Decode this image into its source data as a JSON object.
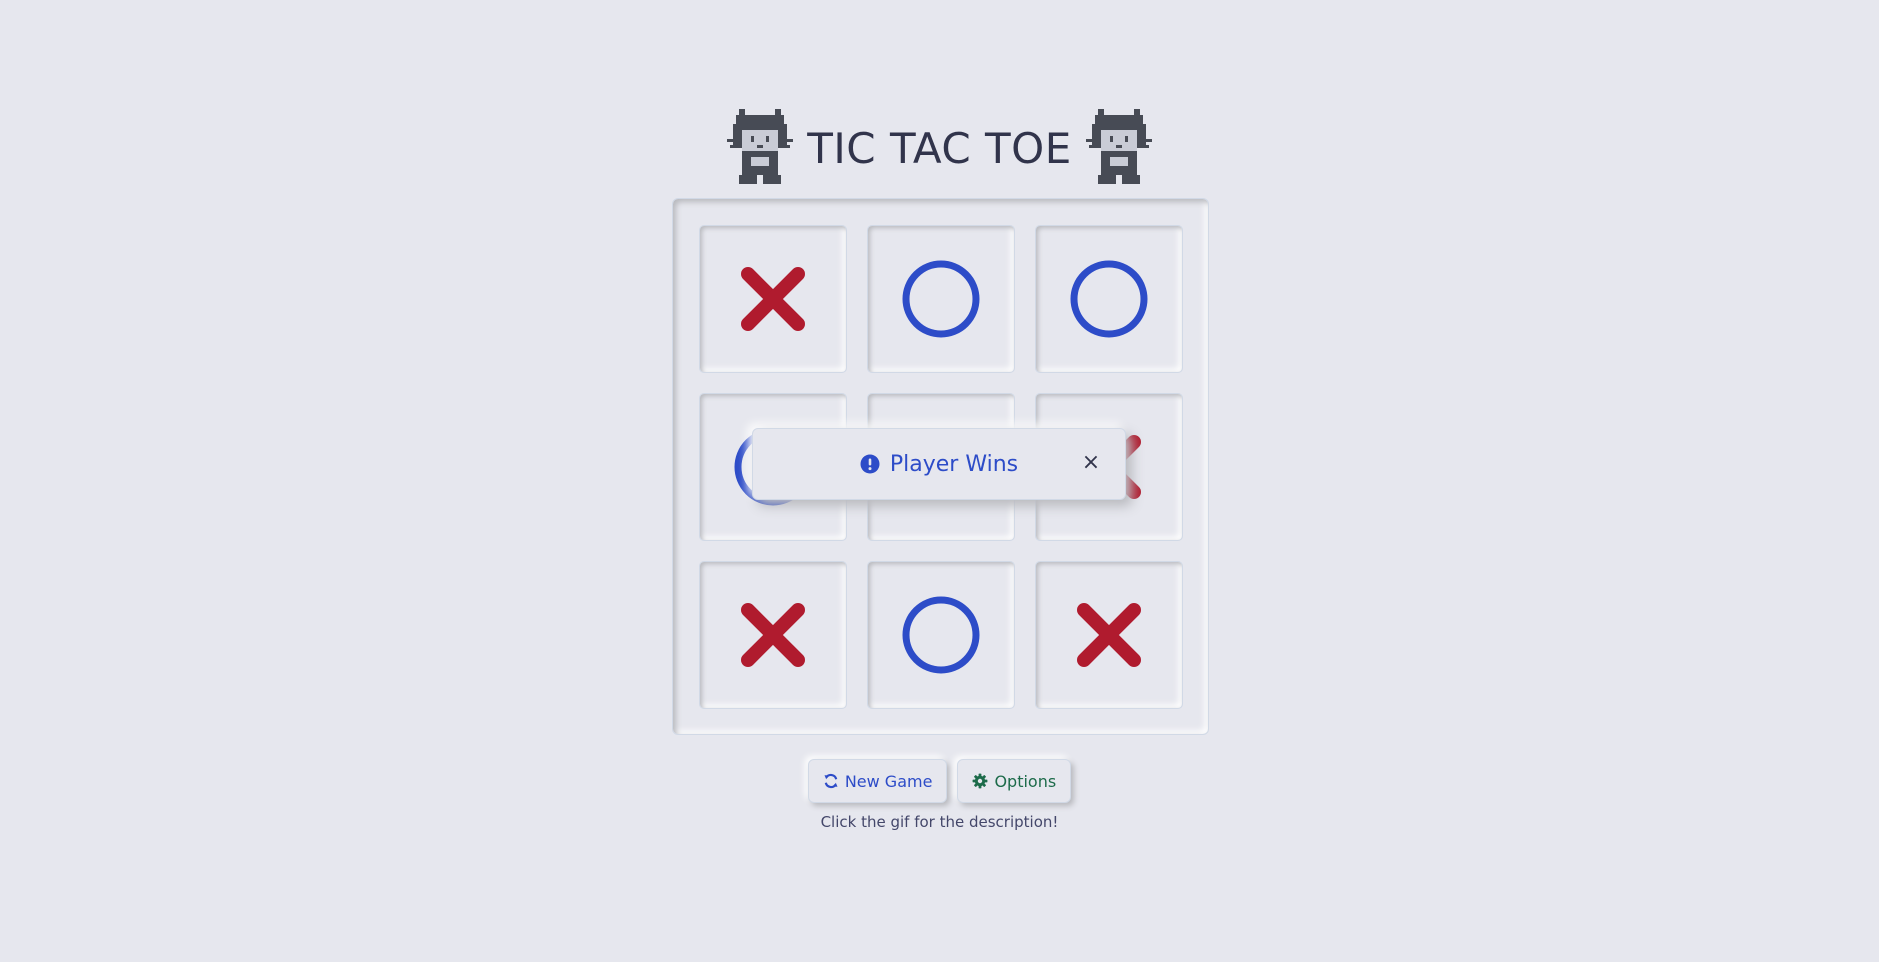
{
  "title": "TIC TAC TOE",
  "board": {
    "cells": [
      "X",
      "O",
      "O",
      "O",
      "",
      "X",
      "X",
      "O",
      "X"
    ]
  },
  "toast": {
    "message": "Player Wins",
    "close_symbol": "×",
    "icon": "exclamation-circle-icon"
  },
  "buttons": {
    "new_game_label": "New Game",
    "new_game_icon": "refresh-icon",
    "options_label": "Options",
    "options_icon": "gear-icon"
  },
  "hint": "Click the gif for the description!",
  "colors": {
    "background": "#e6e7ee",
    "x_color": "#b01b2e",
    "o_color": "#2d4cc8",
    "options_color": "#1d6b4a"
  }
}
